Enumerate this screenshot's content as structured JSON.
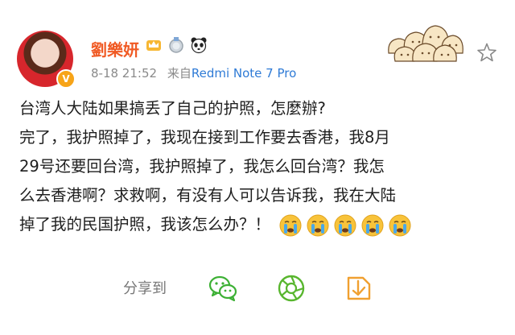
{
  "author": {
    "name": "劉樂妍",
    "verified_badge": "V",
    "badges": [
      "crown-icon",
      "medal-icon",
      "panda-icon"
    ]
  },
  "meta": {
    "time": "8-18 21:52",
    "source_label": "来自",
    "device": "Redmi Note 7 Pro"
  },
  "post": {
    "lines": [
      "台湾人大陆如果搞丢了自己的护照，怎麼辦?",
      "完了，我护照掉了，我现在接到工作要去香港，我8月",
      "29号还要回台湾，我护照掉了，我怎么回台湾？我怎",
      "么去香港啊？求救啊，有没有人可以告诉我，我在大陆",
      "掉了我的民国护照，我该怎么办？！"
    ],
    "emoji": [
      "crying-face-icon",
      "crying-face-icon",
      "crying-face-icon",
      "crying-face-icon",
      "crying-face-icon"
    ]
  },
  "share": {
    "label": "分享到",
    "targets": [
      "wechat-icon",
      "moments-icon",
      "save-image-icon"
    ]
  },
  "colors": {
    "username": "#f05a24",
    "device_link": "#2f7bd6",
    "wechat_green": "#3cb034",
    "moments_green": "#58b62e",
    "save_orange": "#f0a030"
  }
}
